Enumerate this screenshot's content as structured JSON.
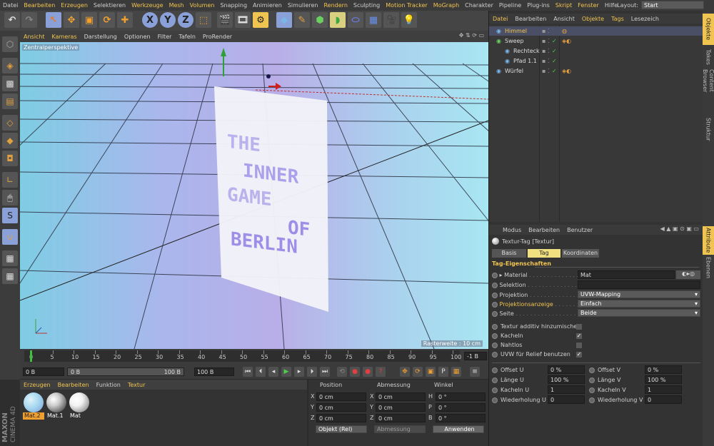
{
  "menubar": {
    "items": [
      {
        "label": "Datei",
        "hl": false
      },
      {
        "label": "Bearbeiten",
        "hl": true
      },
      {
        "label": "Erzeugen",
        "hl": true
      },
      {
        "label": "Selektieren",
        "hl": false
      },
      {
        "label": "Werkzeuge",
        "hl": true
      },
      {
        "label": "Mesh",
        "hl": true
      },
      {
        "label": "Volumen",
        "hl": true
      },
      {
        "label": "Snapping",
        "hl": false
      },
      {
        "label": "Animieren",
        "hl": false
      },
      {
        "label": "Simulieren",
        "hl": false
      },
      {
        "label": "Rendern",
        "hl": true
      },
      {
        "label": "Sculpting",
        "hl": false
      },
      {
        "label": "Motion Tracker",
        "hl": true
      },
      {
        "label": "MoGraph",
        "hl": true
      },
      {
        "label": "Charakter",
        "hl": false
      },
      {
        "label": "Pipeline",
        "hl": false
      },
      {
        "label": "Plug-ins",
        "hl": false
      },
      {
        "label": "Skript",
        "hl": true
      },
      {
        "label": "Fenster",
        "hl": true
      },
      {
        "label": "Hilfe",
        "hl": false
      }
    ],
    "layout_label": "Layout:",
    "layout_value": "Start"
  },
  "toolbar": {
    "icons": [
      "undo-icon",
      "redo-icon",
      "select-arrow-icon",
      "move-icon",
      "scale-icon",
      "rotate-icon",
      "add-icon",
      "x-axis-icon",
      "y-axis-icon",
      "z-axis-icon",
      "coordinate-system-icon",
      "render-view-icon",
      "render-picture-icon",
      "render-settings-icon",
      "cube-icon",
      "pen-icon",
      "subdivision-icon",
      "deformer-icon",
      "floor-icon",
      "camera-icon",
      "light-icon"
    ],
    "axis_x": "X",
    "axis_y": "Y",
    "axis_z": "Z"
  },
  "viewport": {
    "menu": [
      {
        "label": "Ansicht",
        "hl": true
      },
      {
        "label": "Kameras",
        "hl": true
      },
      {
        "label": "Darstellung",
        "hl": false
      },
      {
        "label": "Optionen",
        "hl": false
      },
      {
        "label": "Filter",
        "hl": false
      },
      {
        "label": "Tafeln",
        "hl": false
      },
      {
        "label": "ProRender",
        "hl": false
      }
    ],
    "perspective_label": "Zentralperspektive",
    "grid_label": "Rasterweite : 10 cm",
    "poster_lines": [
      "THE",
      "INNER",
      "GAME",
      "OF",
      "BERLIN"
    ]
  },
  "timeline": {
    "ticks": [
      "0",
      "5",
      "10",
      "15",
      "20",
      "25",
      "30",
      "35",
      "40",
      "45",
      "50",
      "55",
      "60",
      "65",
      "70",
      "75",
      "80",
      "85",
      "90",
      "95",
      "100"
    ],
    "current_frame": "-1 B",
    "start_field": "0 B",
    "min_field": "0 B",
    "max_field": "100 B",
    "end_field": "100 B"
  },
  "materials": {
    "menu": [
      {
        "label": "Erzeugen",
        "hl": true
      },
      {
        "label": "Bearbeiten",
        "hl": true
      },
      {
        "label": "Funktion",
        "hl": false
      },
      {
        "label": "Textur",
        "hl": true
      }
    ],
    "items": [
      {
        "name": "Mat.2",
        "color1": "#a8d8f0",
        "color2": "#7a9fd8",
        "selected": true
      },
      {
        "name": "Mat.1",
        "color1": "#cccccc",
        "color2": "#222222",
        "selected": false
      },
      {
        "name": "Mat",
        "color1": "#f2f2f2",
        "color2": "#6a6a6a",
        "selected": false
      }
    ],
    "brand_line1": "MAXON",
    "brand_line2": "CINEMA 4D"
  },
  "coords": {
    "headers": [
      "Position",
      "Abmessung",
      "Winkel"
    ],
    "rows": [
      {
        "axis": "X",
        "pos": "0 cm",
        "size_axis": "X",
        "size": "0 cm",
        "ang_axis": "H",
        "ang": "0 °"
      },
      {
        "axis": "Y",
        "pos": "0 cm",
        "size_axis": "Y",
        "size": "0 cm",
        "ang_axis": "P",
        "ang": "0 °"
      },
      {
        "axis": "Z",
        "pos": "0 cm",
        "size_axis": "Z",
        "size": "0 cm",
        "ang_axis": "B",
        "ang": "0 °"
      }
    ],
    "mode": "Objekt (Rel)",
    "size_mode": "Abmessung",
    "apply": "Anwenden"
  },
  "objects": {
    "menu": [
      {
        "label": "Datei",
        "hl": true
      },
      {
        "label": "Bearbeiten",
        "hl": false
      },
      {
        "label": "Ansicht",
        "hl": false
      },
      {
        "label": "Objekte",
        "hl": true
      },
      {
        "label": "Tags",
        "hl": true
      },
      {
        "label": "Lesezeich",
        "hl": false
      }
    ],
    "items": [
      {
        "name": "Himmel",
        "indent": 0,
        "hl": true,
        "selected": true
      },
      {
        "name": "Sweep",
        "indent": 0,
        "hl": false,
        "selected": false
      },
      {
        "name": "Rechteck",
        "indent": 1,
        "hl": false,
        "selected": false
      },
      {
        "name": "Pfad 1.1",
        "indent": 1,
        "hl": false,
        "selected": false
      },
      {
        "name": "Würfel",
        "indent": 0,
        "hl": false,
        "selected": false
      }
    ]
  },
  "attributes": {
    "menu": [
      {
        "label": "Modus"
      },
      {
        "label": "Bearbeiten"
      },
      {
        "label": "Benutzer"
      }
    ],
    "title": "Textur-Tag [Textur]",
    "tabs": [
      {
        "label": "Basis",
        "active": false
      },
      {
        "label": "Tag",
        "active": true
      },
      {
        "label": "Koordinaten",
        "active": false
      }
    ],
    "section": "Tag-Eigenschaften",
    "material_label": "Material",
    "material_value": "Mat",
    "selektion_label": "Selektion",
    "projektion_label": "Projektion",
    "projektion_value": "UVW-Mapping",
    "projektionsanzeige_label": "Projektionsanzeige",
    "projektionsanzeige_value": "Einfach",
    "seite_label": "Seite",
    "seite_value": "Beide",
    "checks": [
      {
        "label": "Textur additiv hinzumischen",
        "checked": false
      },
      {
        "label": "Kacheln",
        "checked": true
      },
      {
        "label": "Nahtlos",
        "checked": false
      },
      {
        "label": "UVW für Relief benutzen",
        "checked": true
      }
    ],
    "params": [
      {
        "l_label": "Offset U",
        "l_value": "0 %",
        "r_label": "Offset V",
        "r_value": "0 %"
      },
      {
        "l_label": "Länge U",
        "l_value": "100 %",
        "r_label": "Länge V",
        "r_value": "100 %"
      },
      {
        "l_label": "Kacheln U",
        "l_value": "1",
        "r_label": "Kacheln V",
        "r_value": "1"
      },
      {
        "l_label": "Wiederholung U",
        "l_value": "0",
        "r_label": "Wiederholung V",
        "r_value": "0"
      }
    ]
  },
  "sidetabs": [
    "Objekte",
    "Takes",
    "Content Browser",
    "Struktur",
    "Attribute",
    "Ebenen"
  ],
  "colors": {
    "accent": "#f0c451",
    "active_tab": "#f0e080",
    "selection": "#556",
    "grid": "#1f1f2e"
  }
}
